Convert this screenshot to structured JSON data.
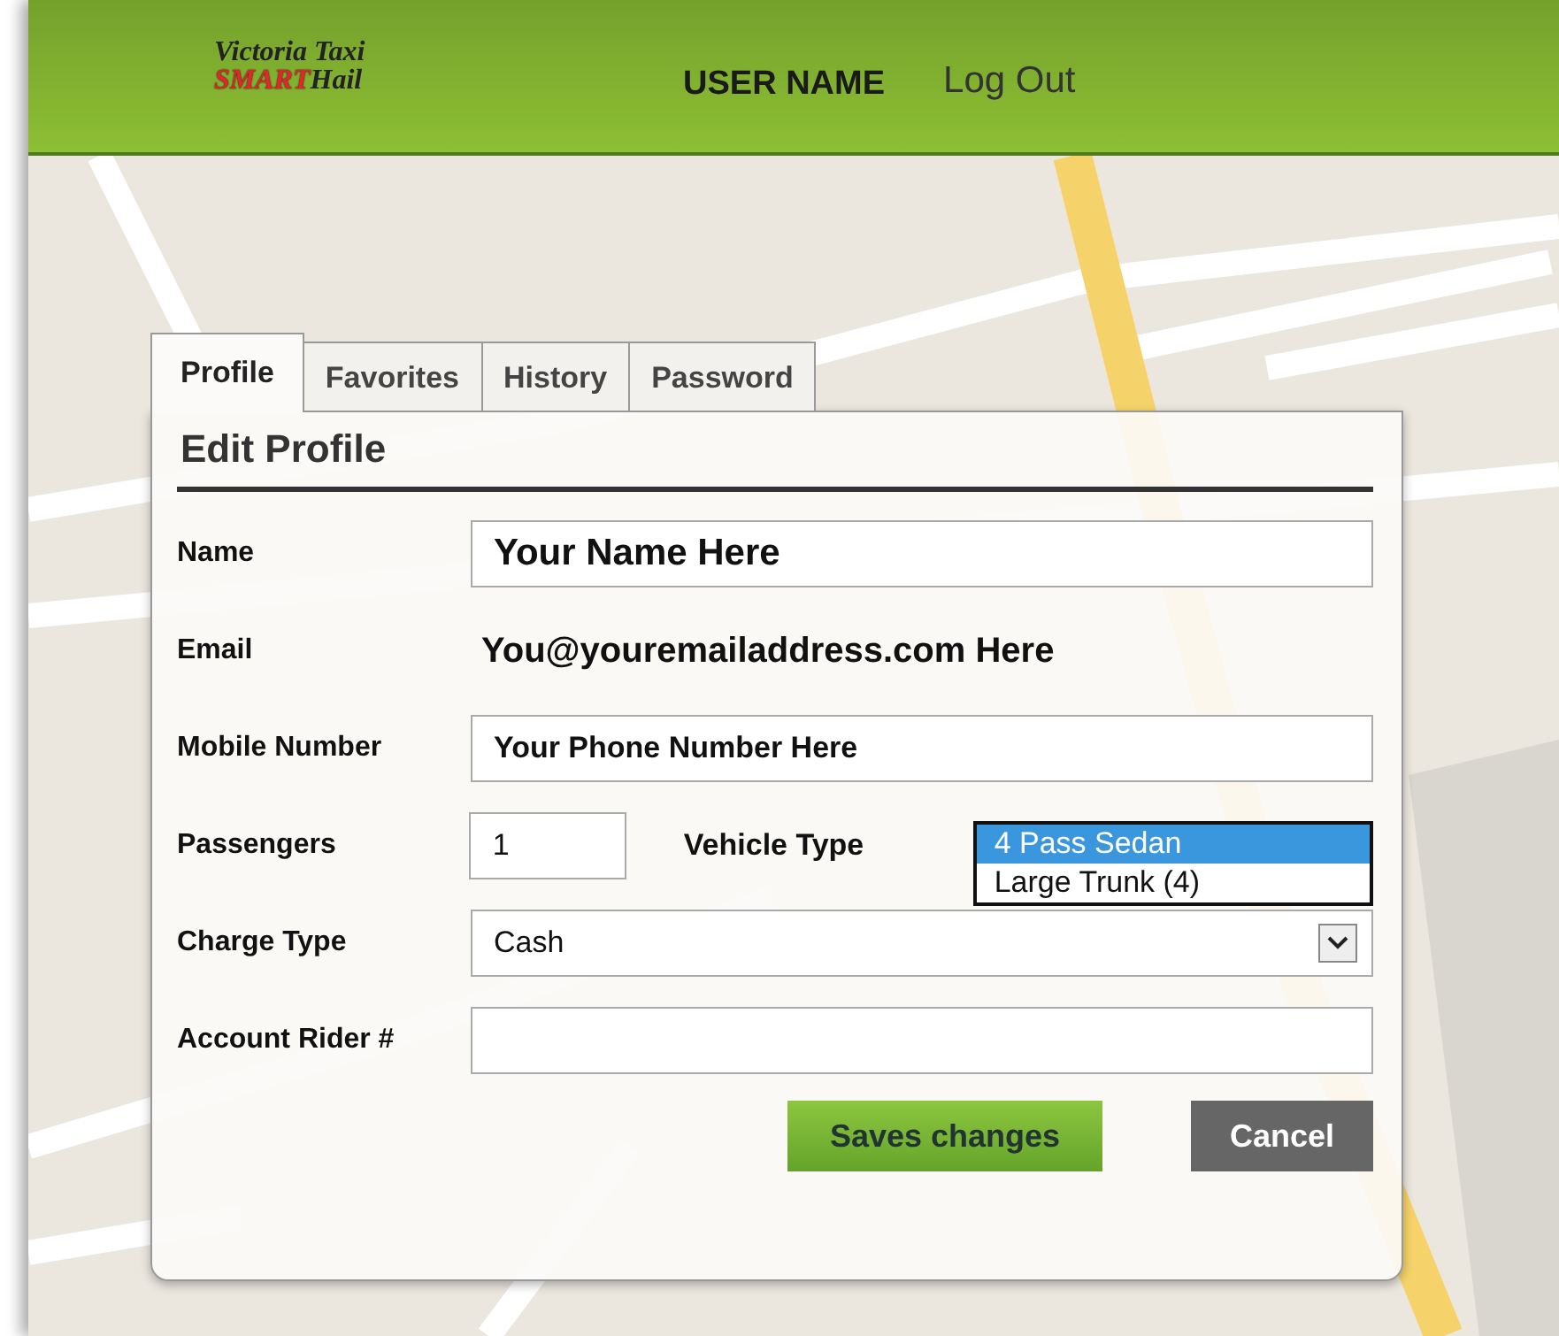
{
  "header": {
    "logo": {
      "line_1": "Victoria Taxi",
      "line_2_red": "SMART",
      "line_2_dark": "Hail"
    },
    "user_name": "USER NAME",
    "logout": "Log Out"
  },
  "tabs": [
    {
      "label": "Profile",
      "selected": true
    },
    {
      "label": "Favorites",
      "selected": false
    },
    {
      "label": "History",
      "selected": false
    },
    {
      "label": "Password",
      "selected": false
    }
  ],
  "form": {
    "title": "Edit Profile",
    "fields": [
      {
        "kind": "large_input",
        "label": "Name",
        "value": "Your Name Here"
      },
      {
        "kind": "static",
        "label": "Email",
        "value": "You@youremailaddress.com Here"
      },
      {
        "kind": "input",
        "label": "Mobile Number",
        "value": "Your Phone Number Here"
      },
      {
        "kind": "pair",
        "label": "Passengers",
        "value": "1",
        "label_2": "Vehicle Type",
        "options": [
          {
            "label": "4 Pass Sedan",
            "selected": true
          },
          {
            "label": "Large Trunk (4)",
            "selected": false
          }
        ]
      },
      {
        "kind": "select",
        "label": "Charge Type",
        "value": "Cash"
      },
      {
        "kind": "input",
        "label": "Account Rider #"
      }
    ]
  },
  "buttons": [
    {
      "kind": "primary",
      "label": "Saves changes"
    },
    {
      "kind": "secondary",
      "label": "Cancel"
    }
  ]
}
